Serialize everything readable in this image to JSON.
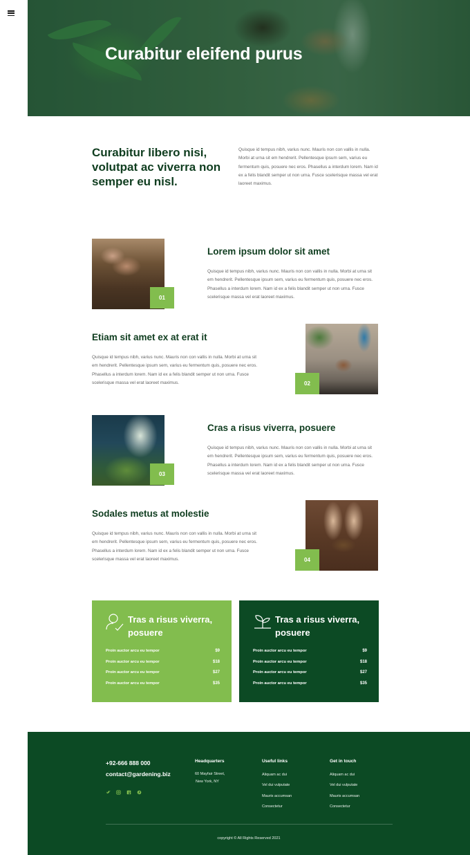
{
  "hero": {
    "title": "Curabitur eleifend purus"
  },
  "intro": {
    "heading": "Curabitur libero nisi, volutpat ac viverra non semper eu nisl.",
    "text": "Quisque id tempus nibh, varius nunc. Mauris non con vallis in nulla. Morbi at urna sit em hendrerit. Pellentesque ipsum sem, varius eu fermentum quis, posuere nec eros. Phasellus a interdum lorem. Nam id ex a felis blandit semper ut non urna. Fusce scelerisque massa vel erat laoreet maximus."
  },
  "items": [
    {
      "number": "01",
      "title": "Lorem ipsum dolor sit amet",
      "text": "Quisque id tempus nibh, varius nunc. Mauris non con vallis in nulla. Morbi at urna sit em hendrerit. Pellentesque ipsum sem, varius eu fermentum quis, posuere nec eros. Phasellus a interdum lorem. Nam id ex a felis blandit semper ut non urna. Fusce scelerisque massa vel erat laoreet maximus."
    },
    {
      "number": "02",
      "title": "Etiam sit amet ex at erat it",
      "text": "Quisque id tempus nibh, varius nunc. Mauris non con vallis in nulla. Morbi at urna sit em hendrerit. Pellentesque ipsum sem, varius eu fermentum quis, posuere nec eros. Phasellus a interdum lorem. Nam id ex a felis blandit semper ut non urna. Fusce scelerisque massa vel erat laoreet maximus."
    },
    {
      "number": "03",
      "title": "Cras a risus viverra, posuere",
      "text": "Quisque id tempus nibh, varius nunc. Mauris non con vallis in nulla. Morbi at urna sit em hendrerit. Pellentesque ipsum sem, varius eu fermentum quis, posuere nec eros. Phasellus a interdum lorem. Nam id ex a felis blandit semper ut non urna. Fusce scelerisque massa vel erat laoreet maximus."
    },
    {
      "number": "04",
      "title": "Sodales metus at molestie",
      "text": "Quisque id tempus nibh, varius nunc. Mauris non con vallis in nulla. Morbi at urna sit em hendrerit. Pellentesque ipsum sem, varius eu fermentum quis, posuere nec eros. Phasellus a interdum lorem. Nam id ex a felis blandit semper ut non urna. Fusce scelerisque massa vel erat laoreet maximus."
    }
  ],
  "price_boxes": [
    {
      "title": "Tras a risus viverra, posuere",
      "icon": "person-check-icon",
      "color": "#82bd4e",
      "rows": [
        {
          "label": "Proin auctor arcu eu tempor",
          "price": "$9"
        },
        {
          "label": "Proin auctor arcu eu tempor",
          "price": "$18"
        },
        {
          "label": "Proin auctor arcu eu tempor",
          "price": "$27"
        },
        {
          "label": "Proin auctor arcu eu tempor",
          "price": "$35"
        }
      ]
    },
    {
      "title": "Tras a risus viverra, posuere",
      "icon": "sprout-icon",
      "color": "#0c4a24",
      "rows": [
        {
          "label": "Proin auctor arcu eu tempor",
          "price": "$9"
        },
        {
          "label": "Proin auctor arcu eu tempor",
          "price": "$18"
        },
        {
          "label": "Proin auctor arcu eu tempor",
          "price": "$27"
        },
        {
          "label": "Proin auctor arcu eu tempor",
          "price": "$35"
        }
      ]
    }
  ],
  "footer": {
    "phone": "+92-666 888 000",
    "email": "contact@gardening.biz",
    "social": [
      "twitter-icon",
      "instagram-icon",
      "facebook-icon",
      "pinterest-icon"
    ],
    "headquarters": {
      "title": "Headquarters",
      "line1": "60  Mayfair Street,",
      "line2": "New York, NY"
    },
    "useful_links": {
      "title": "Useful links",
      "links": [
        "Aliquam ac dui",
        "Vel dui vulputate",
        "Mauris accumsan",
        "Consectetur"
      ]
    },
    "get_in_touch": {
      "title": "Get in touch",
      "links": [
        "Aliquam ac dui",
        "Vel dui vulputate",
        "Mauris accumsan",
        "Consectetur"
      ]
    },
    "copyright": "copyright © All Rights Reserved 2021"
  },
  "colors": {
    "accent_green": "#82bd4e",
    "dark_green": "#0c4a24",
    "heading": "#0f3d1f"
  }
}
